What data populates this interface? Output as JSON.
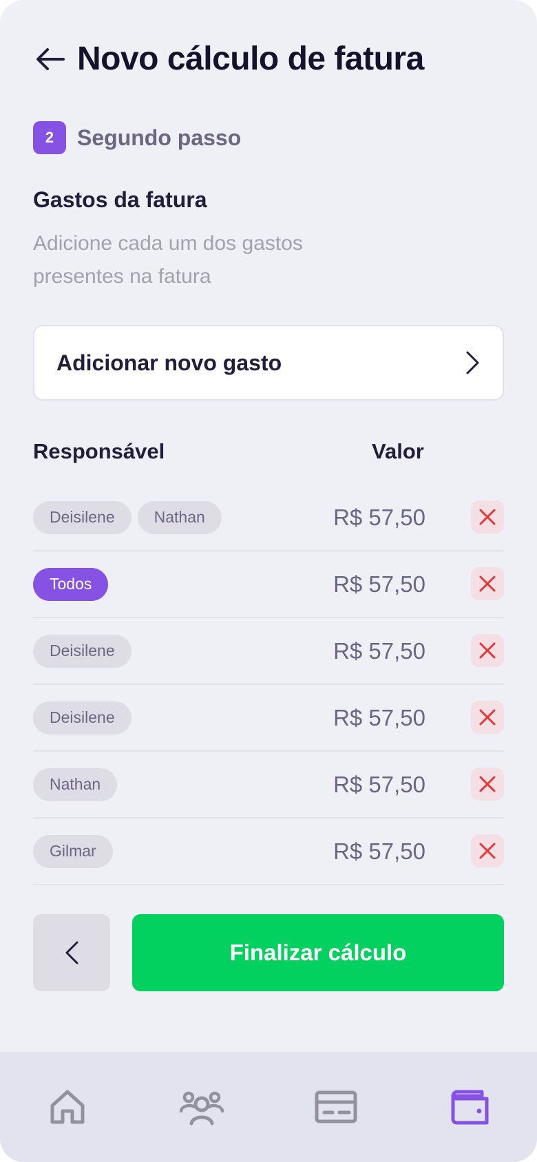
{
  "header": {
    "title": "Novo cálculo de fatura"
  },
  "step": {
    "number": "2",
    "label": "Segundo passo"
  },
  "section": {
    "title": "Gastos da fatura",
    "description": "Adicione cada um dos gastos presentes na fatura"
  },
  "add_expense": {
    "label": "Adicionar novo gasto"
  },
  "table": {
    "columns": {
      "responsible": "Responsável",
      "value": "Valor"
    },
    "rows": [
      {
        "people": [
          "Deisilene",
          "Nathan"
        ],
        "value": "R$ 57,50"
      },
      {
        "people": [
          "Todos"
        ],
        "value": "R$ 57,50",
        "highlight": true
      },
      {
        "people": [
          "Deisilene"
        ],
        "value": "R$ 57,50"
      },
      {
        "people": [
          "Deisilene"
        ],
        "value": "R$ 57,50"
      },
      {
        "people": [
          "Nathan"
        ],
        "value": "R$ 57,50"
      },
      {
        "people": [
          "Gilmar"
        ],
        "value": "R$ 57,50"
      }
    ]
  },
  "actions": {
    "finish_label": "Finalizar cálculo"
  },
  "nav": {
    "items": [
      {
        "icon": "home-icon",
        "active": false
      },
      {
        "icon": "group-icon",
        "active": false
      },
      {
        "icon": "card-icon",
        "active": false
      },
      {
        "icon": "wallet-icon",
        "active": true
      }
    ]
  },
  "colors": {
    "accent": "#8552e4",
    "success": "#03d15f",
    "danger": "#e5383b",
    "text_primary": "#15132b",
    "text_secondary": "#6c6684"
  }
}
